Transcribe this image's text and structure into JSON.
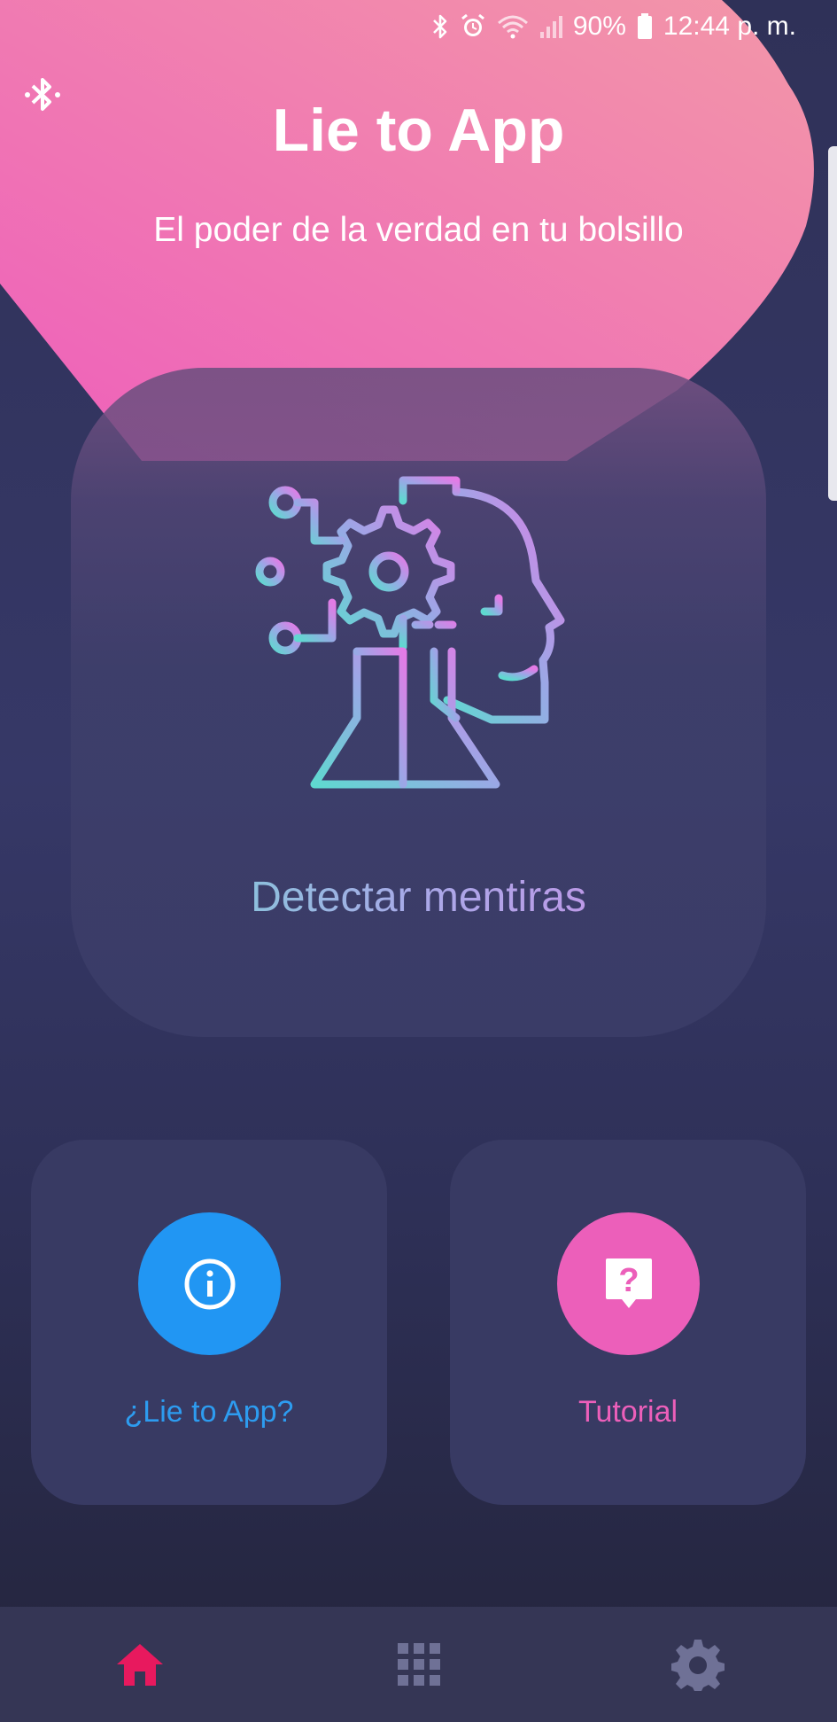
{
  "status_bar": {
    "battery": "90%",
    "time": "12:44 p. m."
  },
  "header": {
    "title": "Lie to App",
    "subtitle": "El poder de la verdad en tu bolsillo"
  },
  "detect_card": {
    "label": "Detectar mentiras",
    "icon": "ai-head-gear-icon"
  },
  "actions": [
    {
      "label": "¿Lie to App?",
      "icon": "info-icon",
      "color": "#2196f3"
    },
    {
      "label": "Tutorial",
      "icon": "help-bubble-icon",
      "color": "#ec5fba"
    }
  ],
  "bottom_nav": [
    {
      "icon": "home-icon",
      "color": "#e8195e",
      "active": true
    },
    {
      "icon": "grid-icon",
      "color": "#6f7196",
      "active": false
    },
    {
      "icon": "gear-icon",
      "color": "#6f7196",
      "active": false
    }
  ],
  "colors": {
    "background": "#33355f",
    "hero_pink": "#ee5fbb",
    "hero_light_pink": "#f290ab",
    "card": "#383a63",
    "nav_bar": "#353655"
  }
}
